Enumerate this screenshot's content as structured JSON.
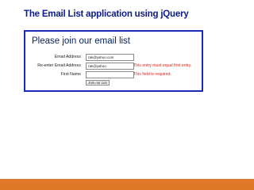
{
  "slide": {
    "title": "The Email List application using jQuery"
  },
  "form": {
    "heading": "Please join our email list",
    "fields": [
      {
        "label": "Email Address",
        "value": "zak@yahoo.com",
        "error": ""
      },
      {
        "label": "Re-enter Email Address",
        "value": "zak@yahoo",
        "error": "This entry must equal first entry."
      },
      {
        "label": "First Name",
        "value": "",
        "error": "This field is required."
      }
    ],
    "submit_label": "Join our List"
  },
  "colors": {
    "slide_title": "#0a1a8c",
    "frame_border": "#1c2ab8",
    "form_heading": "#0a2468",
    "error_text": "#e0201e",
    "footer_bar": "#e0782a"
  }
}
